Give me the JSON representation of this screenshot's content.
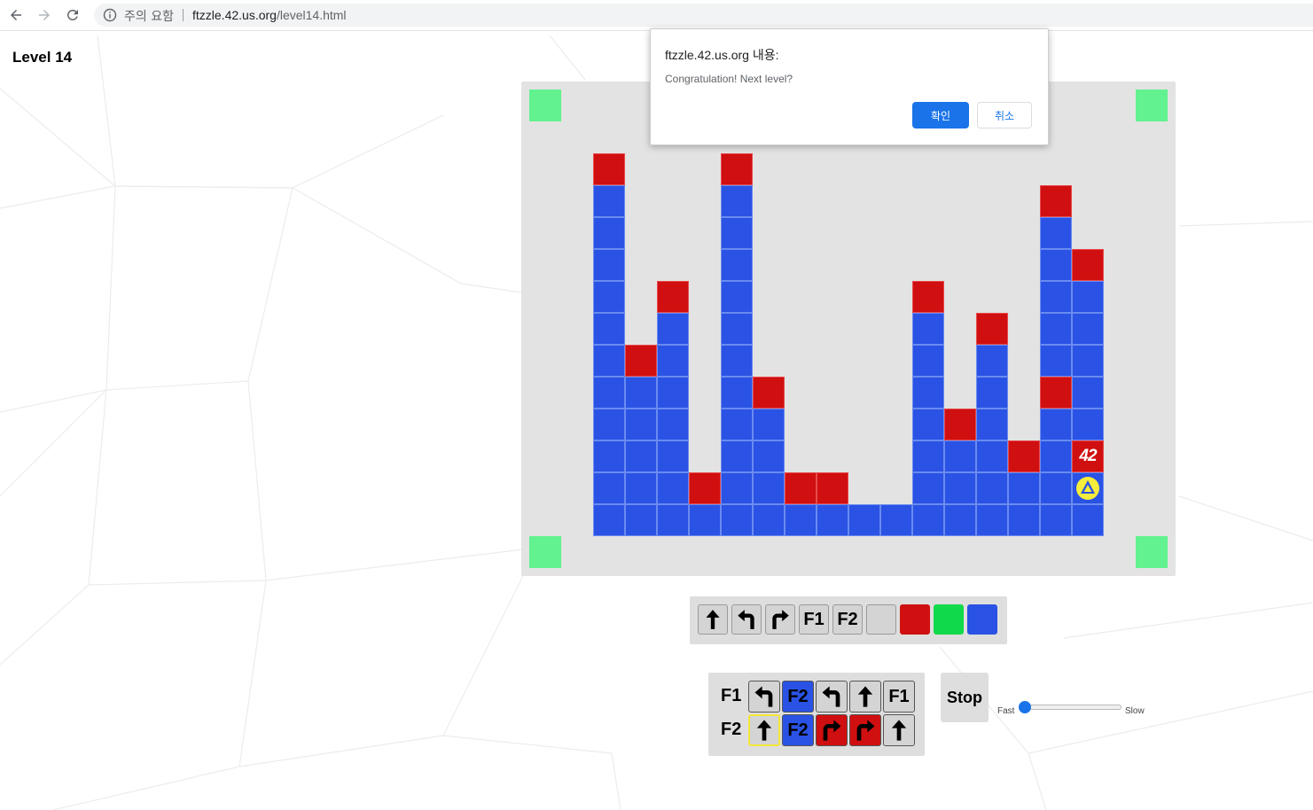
{
  "browser": {
    "security_label": "주의 요함",
    "url_host": "ftzzle.42.us.org",
    "url_path": "/level14.html"
  },
  "level": {
    "title": "Level 14"
  },
  "board": {
    "colors": {
      "blue": "#2a52e4",
      "red": "#d00f10",
      "green": "#62f28f",
      "background": "#e3e3e3"
    },
    "logo_text": "42",
    "robot_direction": "up",
    "rows": [
      "R...R...........",
      "B...B.........R.",
      "B...B.........B.",
      "B...B.........BR",
      "B.R.B.....R...BB",
      "B.B.B.....B.R.BB",
      "BRB.B.....B.B.BB",
      "BBB.BR....B.B.RB",
      "BBB.BB....BRB.BB",
      "BBB.BB....BBBRBB",
      "BBBRBBRR..BBBBBB",
      "BBBBBBBBBBBBBBBB"
    ],
    "logo_column": 15,
    "extra_column": [
      ".",
      ".",
      ".",
      ".",
      ".",
      ".",
      ".",
      ".",
      ".",
      "L",
      "T",
      "B"
    ]
  },
  "palette": {
    "items": [
      {
        "kind": "icon",
        "icon": "arrow-up-icon"
      },
      {
        "kind": "icon",
        "icon": "turn-left-icon"
      },
      {
        "kind": "icon",
        "icon": "turn-right-icon"
      },
      {
        "kind": "text",
        "label": "F1"
      },
      {
        "kind": "text",
        "label": "F2"
      },
      {
        "kind": "color",
        "color": "none"
      },
      {
        "kind": "color",
        "color": "#d00f10"
      },
      {
        "kind": "color",
        "color": "#10d94b"
      },
      {
        "kind": "color",
        "color": "#2a52e4"
      }
    ]
  },
  "program": {
    "functions": [
      {
        "label": "F1",
        "slots": [
          {
            "icon": "turn-left-icon",
            "color": "none"
          },
          {
            "text": "F2",
            "color": "blue"
          },
          {
            "icon": "turn-left-icon",
            "color": "none"
          },
          {
            "icon": "arrow-up-icon",
            "color": "none"
          },
          {
            "text": "F1",
            "color": "none"
          }
        ]
      },
      {
        "label": "F2",
        "slots": [
          {
            "icon": "arrow-up-icon",
            "color": "none",
            "current": true
          },
          {
            "text": "F2",
            "color": "blue"
          },
          {
            "icon": "turn-right-icon",
            "color": "red"
          },
          {
            "icon": "turn-right-icon",
            "color": "red"
          },
          {
            "icon": "arrow-up-icon",
            "color": "none"
          }
        ]
      }
    ]
  },
  "controls": {
    "stop_label": "Stop",
    "speed_fast_label": "Fast",
    "speed_slow_label": "Slow",
    "speed_value": 0
  },
  "dialog": {
    "title": "ftzzle.42.us.org 내용:",
    "message": "Congratulation! Next level?",
    "ok_label": "확인",
    "cancel_label": "취소"
  }
}
